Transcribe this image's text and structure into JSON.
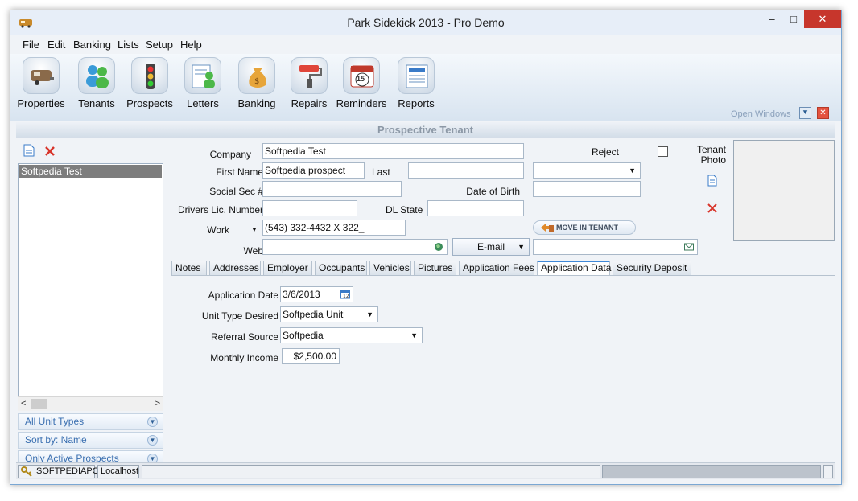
{
  "window": {
    "title": "Park Sidekick 2013 - Pro Demo",
    "minimize": "–",
    "maximize": "□",
    "close": "✕"
  },
  "menu": [
    "File",
    "Edit",
    "Banking",
    "Lists",
    "Setup",
    "Help"
  ],
  "toolbar": {
    "items": [
      "Properties",
      "Tenants",
      "Prospects",
      "Letters",
      "Banking",
      "Repairs",
      "Reminders",
      "Reports"
    ],
    "reminder_badge": "15",
    "open_windows": "Open Windows"
  },
  "section_header": "Prospective Tenant",
  "left_panel": {
    "list_items": [
      "Softpedia Test"
    ],
    "filters": [
      "All Unit Types",
      "Sort by: Name",
      "Only Active Prospects"
    ]
  },
  "form": {
    "company_label": "Company",
    "company_value": "Softpedia Test",
    "reject_label": "Reject",
    "tenant_photo_label": "Tenant\nPhoto",
    "first_name_label": "First Name",
    "first_name_value": "Softpedia prospect",
    "last_label": "Last",
    "last_value": "",
    "suffix_value": "",
    "ssn_label": "Social Sec #",
    "ssn_value": "",
    "dob_label": "Date of Birth",
    "dob_value": "",
    "dl_label": "Drivers Lic. Number",
    "dl_value": "",
    "dl_state_label": "DL State",
    "dl_state_value": "",
    "phone_type_label": "Work",
    "phone_value": "(543) 332-4432 X 322_",
    "move_in_label": "MOVE IN TENANT",
    "web_label": "Web",
    "web_value": "",
    "email_type": "E-mail",
    "email_value": ""
  },
  "tabs": [
    {
      "label": "Notes",
      "active": false
    },
    {
      "label": "Addresses",
      "active": false
    },
    {
      "label": "Employer",
      "active": false
    },
    {
      "label": "Occupants",
      "active": false
    },
    {
      "label": "Vehicles",
      "active": false
    },
    {
      "label": "Pictures",
      "active": false
    },
    {
      "label": "Application Fees",
      "active": false
    },
    {
      "label": "Application Data",
      "active": true
    },
    {
      "label": "Security Deposit",
      "active": false
    }
  ],
  "application_data": {
    "app_date_label": "Application Date",
    "app_date_value": "3/6/2013",
    "unit_type_label": "Unit Type Desired",
    "unit_type_value": "Softpedia Unit",
    "referral_label": "Referral Source",
    "referral_value": "Softpedia",
    "income_label": "Monthly Income",
    "income_value": "$2,500.00"
  },
  "status": {
    "computer": "SOFTPEDIAPC",
    "server": "Localhost"
  },
  "colors": {
    "accent": "#3f88d8",
    "close_red": "#c7362c",
    "delete_red": "#d8342a"
  }
}
